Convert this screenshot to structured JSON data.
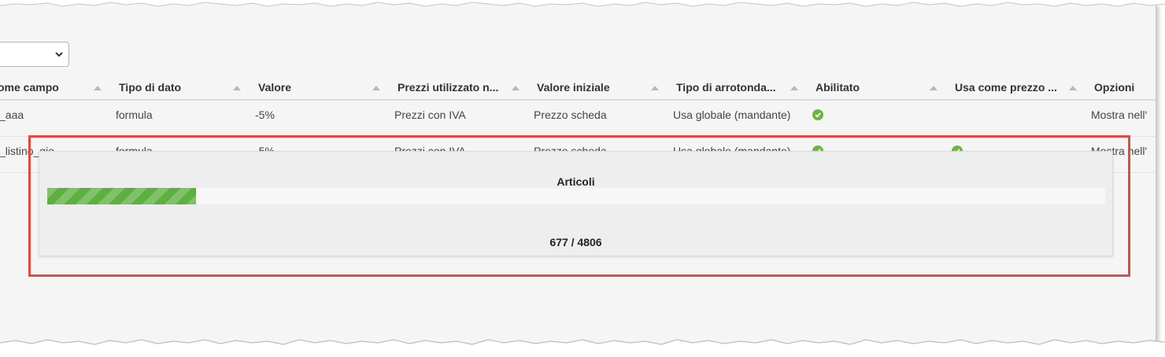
{
  "filter": {
    "selected_value": ""
  },
  "table": {
    "columns": [
      "ome campo",
      "Tipo di dato",
      "Valore",
      "Prezzi utilizzato n...",
      "Valore iniziale",
      "Tipo di arrotonda...",
      "Abilitato",
      "Usa come prezzo ...",
      "Opzioni"
    ],
    "rows": [
      {
        "name": "_aaa",
        "type": "formula",
        "value": "-5%",
        "prices": "Prezzi con IVA",
        "initial": "Prezzo scheda",
        "rounding": "Usa globale (mandante)",
        "enabled": true,
        "use_as_price": false,
        "options": "Mostra nell'"
      },
      {
        "name": "_listino_gio",
        "type": "formula",
        "value": "-5%",
        "prices": "Prezzi con IVA",
        "initial": "Prezzo scheda",
        "rounding": "Usa globale (mandante)",
        "enabled": true,
        "use_as_price": true,
        "options": "Mostra nell'"
      }
    ]
  },
  "progress_dialog": {
    "title": "Articoli",
    "current": 677,
    "total": 4806,
    "count_label": "677 / 4806"
  },
  "colors": {
    "accent_green": "#5cb040",
    "highlight_red": "#e04a3f",
    "check_green": "#6cb83c"
  },
  "icons": {
    "enabled_icon": "check-circle-icon",
    "sort_icon": "sort-up-icon",
    "dropdown_icon": "chevron-down-icon"
  }
}
